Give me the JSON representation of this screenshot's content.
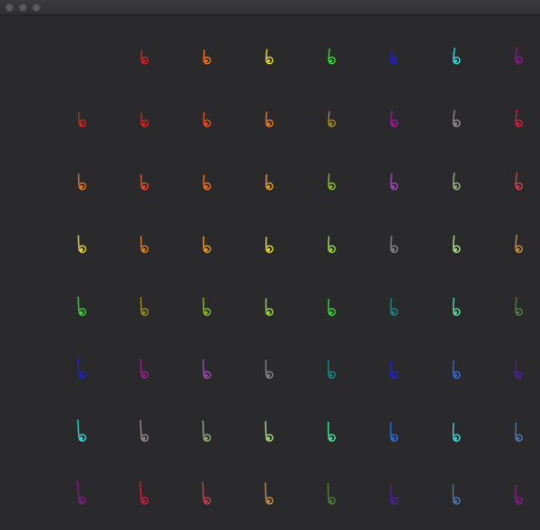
{
  "window": {
    "controls": [
      "close",
      "minimize",
      "zoom"
    ]
  },
  "grid": {
    "rows": 8,
    "cols": 8,
    "colors": [
      [
        null,
        "#e02020",
        "#f07820",
        "#f0e020",
        "#30e030",
        "#2020d8",
        "#30e0e0",
        "#8a1a8a"
      ],
      [
        "#e02020",
        "#e02020",
        "#e85020",
        "#e88020",
        "#a09020",
        "#9a2090",
        "#9a8a8a",
        "#d0203a"
      ],
      [
        "#f07820",
        "#e85020",
        "#f07820",
        "#f0a020",
        "#90c020",
        "#9a50b0",
        "#98b080",
        "#d04050"
      ],
      [
        "#f0e020",
        "#e88020",
        "#f0a020",
        "#f0e020",
        "#a0e030",
        "#888888",
        "#b0e080",
        "#d09040"
      ],
      [
        "#30e030",
        "#a09020",
        "#90c020",
        "#a0e030",
        "#30e030",
        "#1a8a8a",
        "#50e0a0",
        "#508040"
      ],
      [
        "#2020d8",
        "#9a2090",
        "#9a50b0",
        "#888888",
        "#1a8a8a",
        "#2020d8",
        "#3070e0",
        "#5020a0"
      ],
      [
        "#30e0e0",
        "#9a8a8a",
        "#98b080",
        "#b0e080",
        "#50e0a0",
        "#3070e0",
        "#30e0e0",
        "#4a7ab0"
      ],
      [
        "#8a1a8a",
        "#d0203a",
        "#d04050",
        "#d09040",
        "#508040",
        "#5020a0",
        "#4a7ab0",
        "#8a1a8a"
      ]
    ]
  }
}
